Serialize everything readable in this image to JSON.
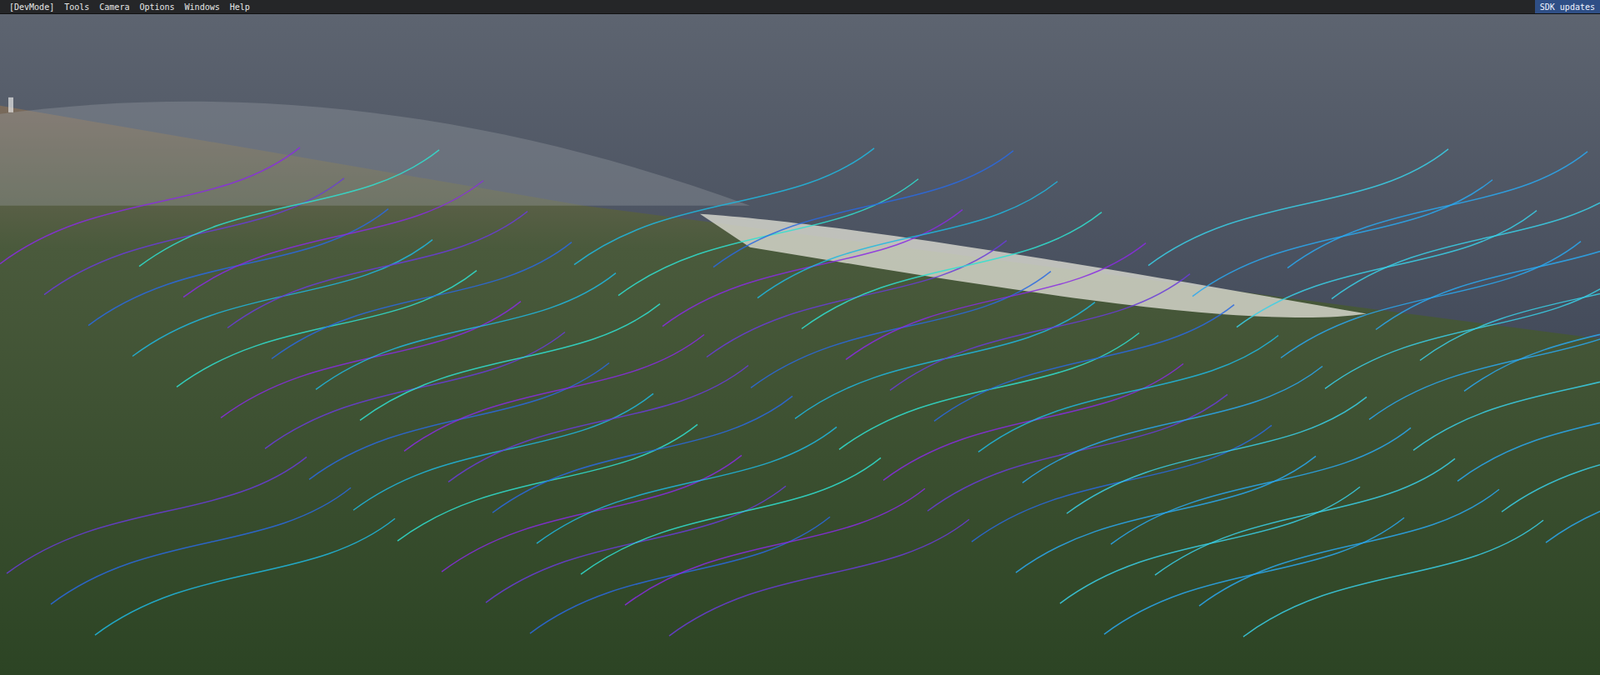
{
  "menu_bar": {
    "items": [
      "[DevMode]",
      "Tools",
      "Camera",
      "Options",
      "Windows",
      "Help"
    ],
    "right_button": "SDK updates"
  }
}
